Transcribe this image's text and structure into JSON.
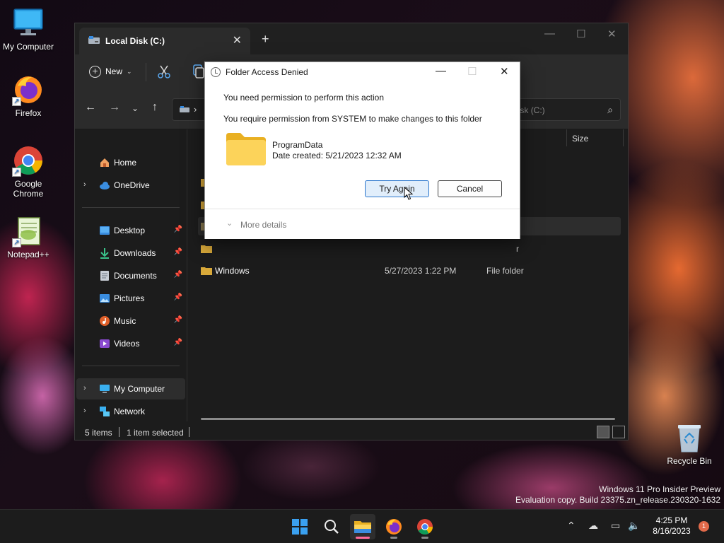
{
  "desktop": {
    "icons": [
      {
        "label": "My Computer",
        "icon": "monitor-icon"
      },
      {
        "label": "Firefox",
        "icon": "firefox-icon"
      },
      {
        "label": "Google Chrome",
        "icon": "chrome-icon"
      },
      {
        "label": "Notepad++",
        "icon": "notepad-plus-plus-icon"
      }
    ],
    "recycle_bin": "Recycle Bin",
    "watermark": [
      "Windows 11 Pro Insider Preview",
      "Evaluation copy. Build 23375.zn_release.230320-1632"
    ]
  },
  "explorer": {
    "tab_title": "Local Disk (C:)",
    "new_tab": "+",
    "toolbar": {
      "new_label": "New"
    },
    "search_placeholder": "Search Local Disk (C:)",
    "search_visible_text": "Local Disk (C:)",
    "columns": {
      "size": "Size"
    },
    "sidebar": {
      "items": [
        {
          "label": "Home",
          "icon": "home-icon",
          "expander": false,
          "pinned": false
        },
        {
          "label": "OneDrive",
          "icon": "cloud-icon",
          "expander": true,
          "pinned": false
        },
        {
          "label": "Desktop",
          "icon": "desktop-icon",
          "expander": false,
          "pinned": true
        },
        {
          "label": "Downloads",
          "icon": "download-icon",
          "expander": false,
          "pinned": true
        },
        {
          "label": "Documents",
          "icon": "document-icon",
          "expander": false,
          "pinned": true
        },
        {
          "label": "Pictures",
          "icon": "picture-icon",
          "expander": false,
          "pinned": true
        },
        {
          "label": "Music",
          "icon": "music-icon",
          "expander": false,
          "pinned": true
        },
        {
          "label": "Videos",
          "icon": "video-icon",
          "expander": false,
          "pinned": true
        },
        {
          "label": "My Computer",
          "icon": "computer-icon",
          "expander": true,
          "pinned": false,
          "selected": true
        },
        {
          "label": "Network",
          "icon": "network-icon",
          "expander": true,
          "pinned": false
        }
      ]
    },
    "files": [
      {
        "name": "Windows",
        "date": "5/27/2023 1:22 PM",
        "type": "File folder"
      }
    ],
    "partial_type_text": "r",
    "status": {
      "items": "5 items",
      "selected": "1 item selected"
    }
  },
  "dialog": {
    "title": "Folder Access Denied",
    "message1": "You need permission to perform this action",
    "message2": "You require permission from SYSTEM to make changes to this folder",
    "folder_name": "ProgramData",
    "folder_date": "Date created: 5/21/2023 12:32 AM",
    "try_again": "Try Again",
    "cancel": "Cancel",
    "more_details": "More details"
  },
  "taskbar": {
    "apps": [
      "start-icon",
      "search-icon",
      "file-explorer-icon",
      "firefox-icon",
      "chrome-icon"
    ],
    "time": "4:25 PM",
    "date": "8/16/2023",
    "notifications": "1"
  },
  "colors": {
    "accent": "#2a75cc",
    "folder": "#f7c948",
    "explorer_bg": "#1c1c1c",
    "taskbar_active": "#ff6a9a"
  }
}
